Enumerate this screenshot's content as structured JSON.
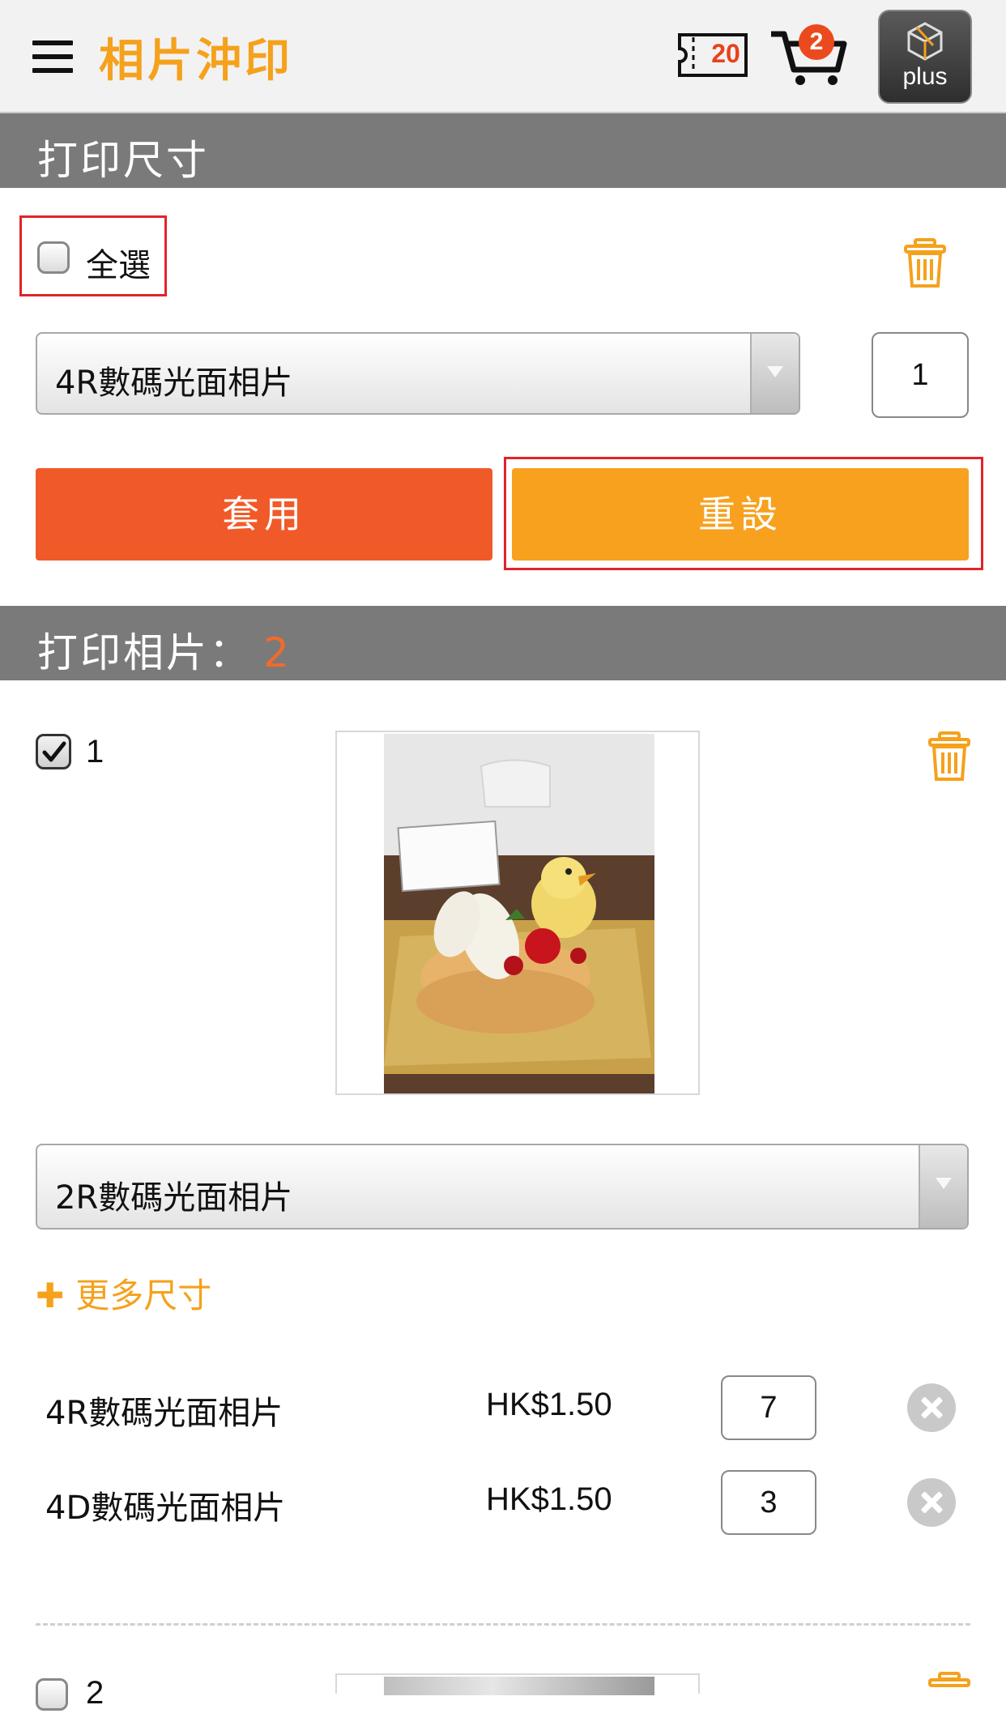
{
  "header": {
    "title": "相片沖印",
    "coupon_count": "20",
    "cart_count": "2",
    "plus_label": "plus"
  },
  "print_size_section": {
    "title": "打印尺寸",
    "select_all_label": "全選",
    "size_select": "4R數碼光面相片",
    "quantity": "1",
    "apply_label": "套用",
    "reset_label": "重設"
  },
  "print_photos_section": {
    "title": "打印相片：",
    "count": "2",
    "items": [
      {
        "index": "1",
        "checked": true,
        "size_select": "2R數碼光面相片",
        "more_sizes_label": "更多尺寸",
        "sizes": [
          {
            "name": "4R數碼光面相片",
            "price": "HK$1.50",
            "quantity": "7"
          },
          {
            "name": "4D數碼光面相片",
            "price": "HK$1.50",
            "quantity": "3"
          }
        ]
      },
      {
        "index": "2",
        "checked": false
      }
    ]
  },
  "colors": {
    "accent_orange": "#f5a11c",
    "apply_button": "#f05a28",
    "reset_button": "#f7a11f",
    "section_header": "#7a7a7a",
    "highlight_red": "#e0242c"
  }
}
